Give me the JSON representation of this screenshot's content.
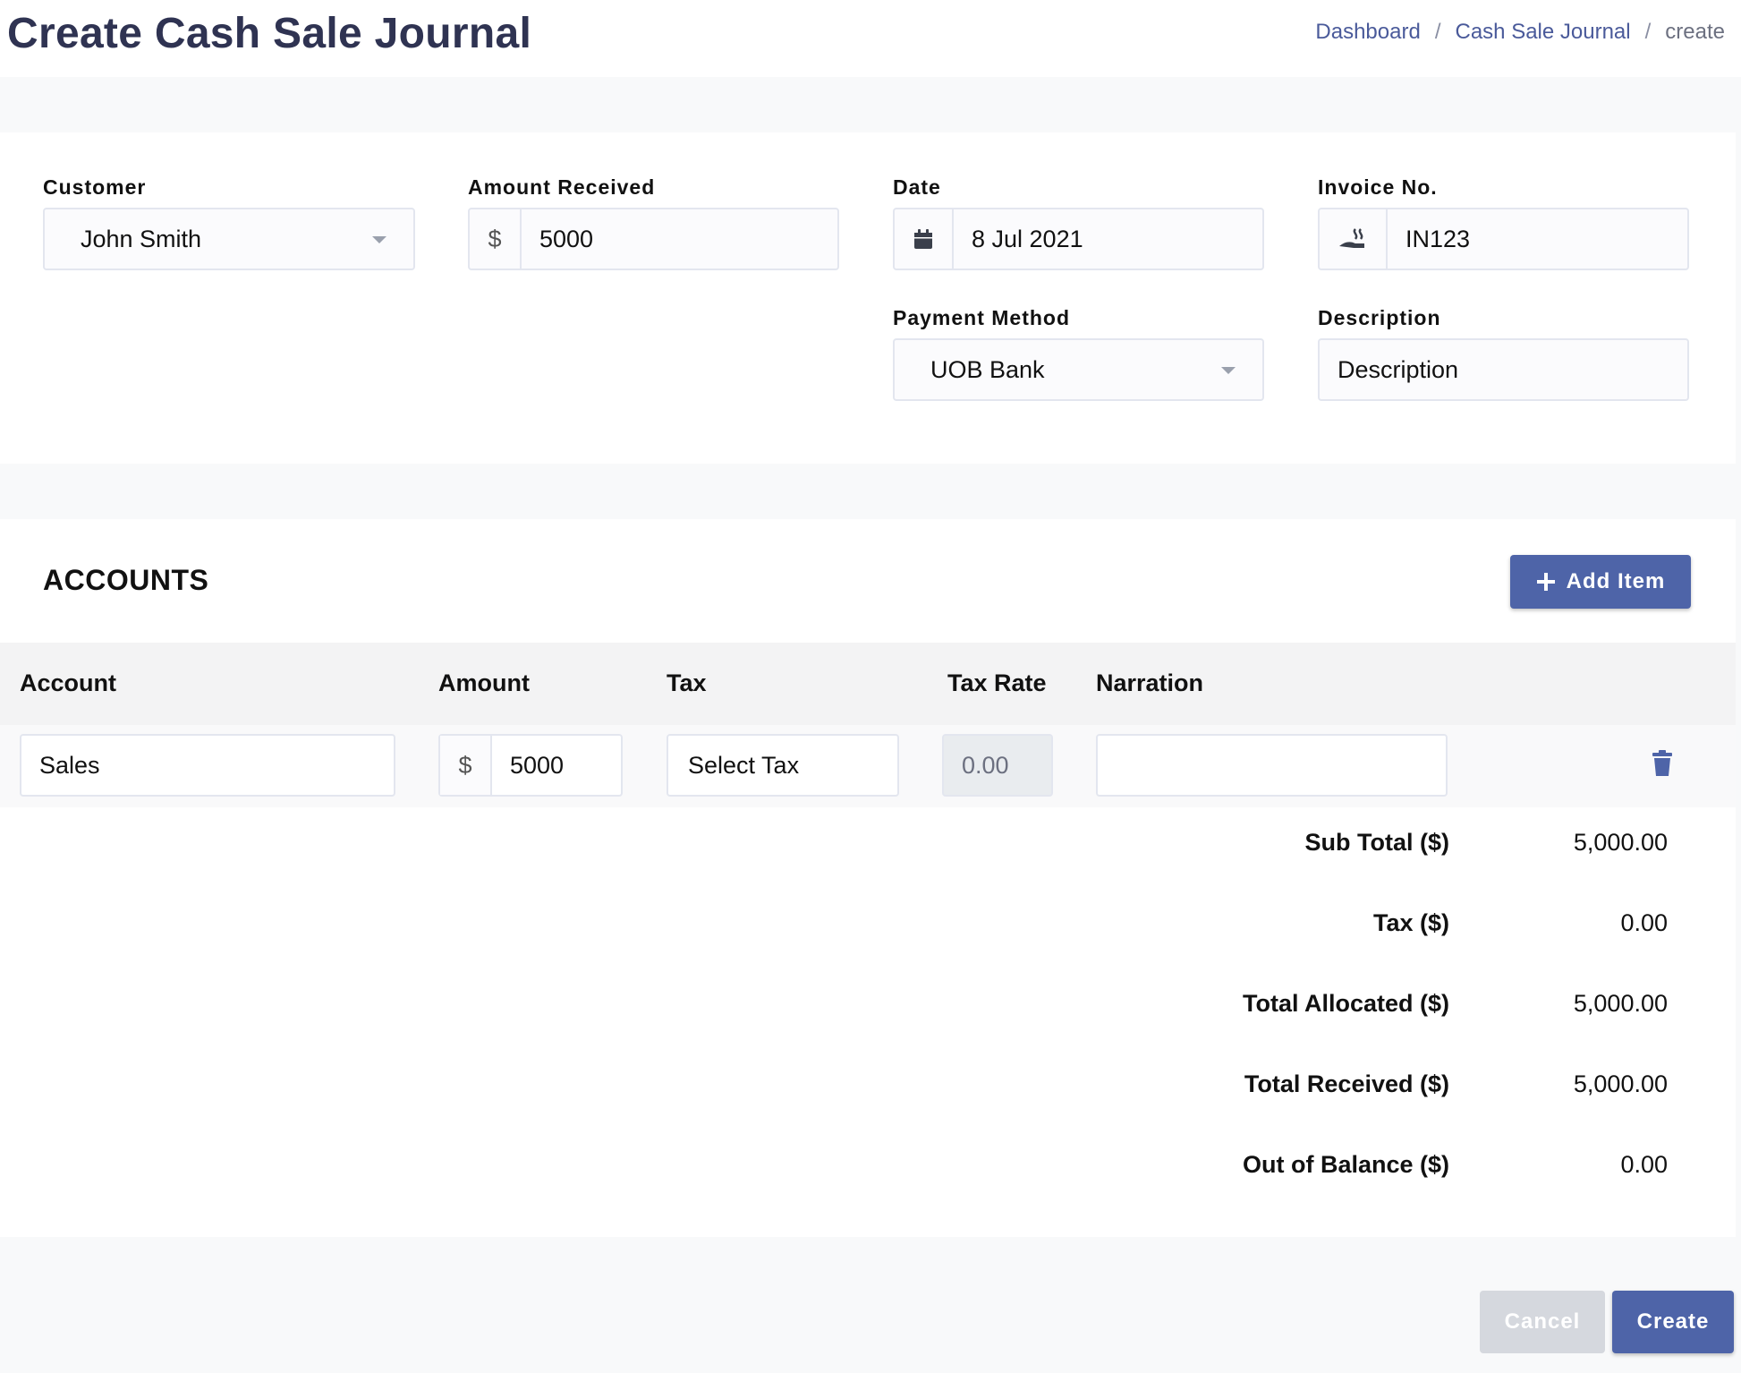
{
  "header": {
    "title": "Create Cash Sale Journal",
    "breadcrumb": {
      "dashboard": "Dashboard",
      "sep1": "/",
      "journal": "Cash Sale Journal",
      "sep2": "/",
      "current": "create"
    }
  },
  "form": {
    "customer": {
      "label": "Customer",
      "value": "John Smith"
    },
    "amount_received": {
      "label": "Amount Received",
      "currency_symbol": "$",
      "value": "5000"
    },
    "date": {
      "label": "Date",
      "value": "8 Jul 2021",
      "icon": "calendar-icon"
    },
    "invoice_no": {
      "label": "Invoice No.",
      "value": "IN123",
      "icon": "hand-holding-icon"
    },
    "payment_method": {
      "label": "Payment Method",
      "value": "UOB Bank"
    },
    "description": {
      "label": "Description",
      "placeholder": "Description"
    }
  },
  "accounts": {
    "title": "ACCOUNTS",
    "add_item_label": "Add Item",
    "columns": [
      "Account",
      "Amount",
      "Tax",
      "Tax Rate",
      "Narration"
    ],
    "rows": [
      {
        "account": "Sales",
        "currency_symbol": "$",
        "amount": "5000",
        "tax": "Select Tax",
        "tax_rate": "0.00",
        "narration": ""
      }
    ],
    "totals": [
      {
        "label": "Sub Total ($)",
        "value": "5,000.00"
      },
      {
        "label": "Tax ($)",
        "value": "0.00"
      },
      {
        "label": "Total Allocated ($)",
        "value": "5,000.00"
      },
      {
        "label": "Total Received ($)",
        "value": "5,000.00"
      },
      {
        "label": "Out of Balance ($)",
        "value": "0.00"
      }
    ]
  },
  "actions": {
    "cancel_label": "Cancel",
    "create_label": "Create"
  },
  "colors": {
    "primary": "#4e64a8",
    "title": "#2f3352",
    "link": "#4a5a9a",
    "danger_icon": "#4e64a8"
  }
}
